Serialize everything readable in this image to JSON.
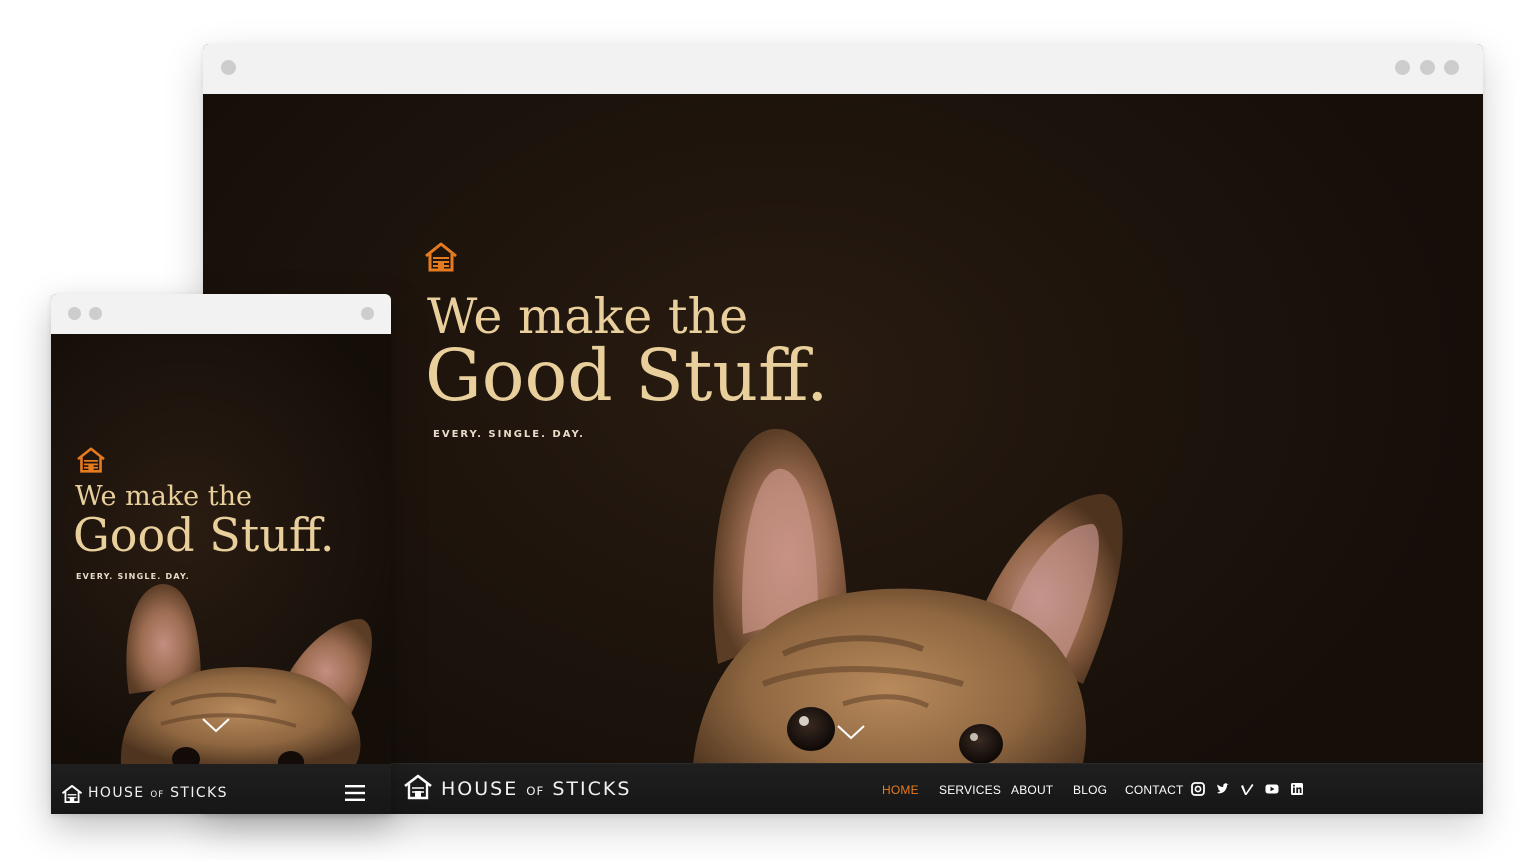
{
  "desktop": {
    "hero": {
      "line1": "We make the",
      "line2": "Good Stuff.",
      "tagline": "EVERY. SINGLE. DAY."
    },
    "nav": {
      "brand_house": "HOUSE",
      "brand_of": "OF",
      "brand_sticks": "STICKS",
      "items": [
        {
          "label": "HOME",
          "active": true
        },
        {
          "label": "SERVICES",
          "active": false
        },
        {
          "label": "ABOUT",
          "active": false
        },
        {
          "label": "BLOG",
          "active": false
        },
        {
          "label": "CONTACT",
          "active": false
        }
      ],
      "social_icons": [
        "instagram-icon",
        "twitter-icon",
        "vimeo-icon",
        "youtube-icon",
        "linkedin-icon"
      ]
    }
  },
  "mobile": {
    "hero": {
      "line1": "We make the",
      "line2": "Good Stuff.",
      "tagline": "EVERY. SINGLE. DAY."
    },
    "nav": {
      "brand_house": "HOUSE",
      "brand_of": "OF",
      "brand_sticks": "STICKS",
      "menu_icon": "hamburger-menu-icon"
    }
  },
  "colors": {
    "accent": "#e57a1e",
    "headline": "#e9cf9c",
    "nav_bg": "#1a1a1a",
    "hero_bg": "#1b120c",
    "chrome": "#f2f2f2"
  }
}
